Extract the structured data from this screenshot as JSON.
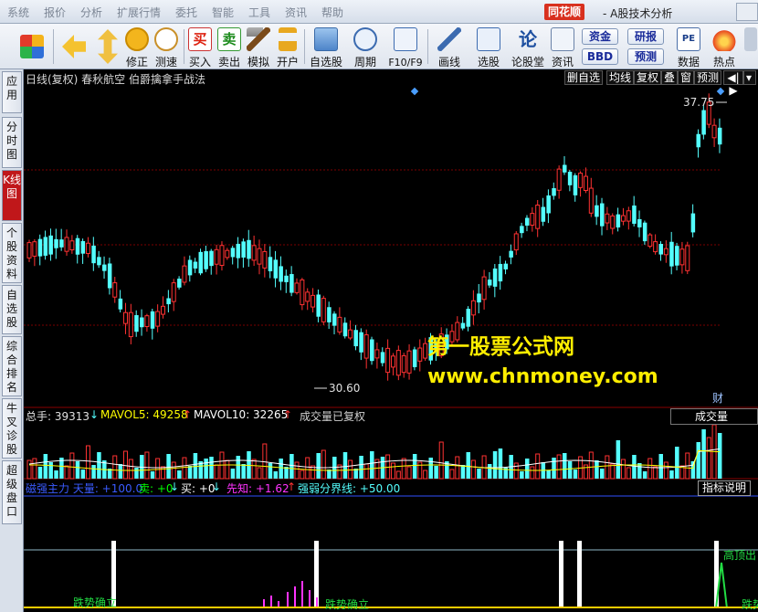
{
  "menu": {
    "items": [
      "系统",
      "报价",
      "分析",
      "扩展行情",
      "委托",
      "智能",
      "工具",
      "资讯",
      "帮助"
    ],
    "brand": "同花顺",
    "title": "- A股技术分析"
  },
  "toolbar": {
    "buttons": [
      {
        "icon": "color-blocks-icon",
        "label": ""
      },
      {
        "icon": "back-arrow-icon",
        "label": ""
      },
      {
        "icon": "updown-arrows-icon",
        "label": ""
      },
      {
        "icon": "fix-coin-icon",
        "label": "修正"
      },
      {
        "icon": "clock-icon",
        "label": "测速"
      },
      {
        "icon": "buy-icon",
        "label": "买入",
        "glyph": "买"
      },
      {
        "icon": "sell-icon",
        "label": "卖出",
        "glyph": "卖"
      },
      {
        "icon": "hammer-icon",
        "label": "模拟"
      },
      {
        "icon": "lock-icon",
        "label": "开户"
      },
      {
        "icon": "self-select-icon",
        "label": "自选股"
      },
      {
        "icon": "period-clock-icon",
        "label": "周期"
      },
      {
        "icon": "f10-icon",
        "label": "F10/F9"
      },
      {
        "icon": "pen-icon",
        "label": "画线"
      },
      {
        "icon": "stock-select-icon",
        "label": "选股"
      },
      {
        "icon": "forum-icon",
        "label": "论股堂",
        "glyph": "论"
      },
      {
        "icon": "news-icon",
        "label": "资讯"
      },
      {
        "icon": "pe-icon",
        "label": "数据",
        "glyph": "PE"
      },
      {
        "icon": "hot-icon",
        "label": "热点"
      }
    ],
    "pills": [
      "资金",
      "研报",
      "BBD",
      "预测"
    ]
  },
  "left_tabs": [
    {
      "label": "应用",
      "active": false
    },
    {
      "label": "分时图",
      "active": false
    },
    {
      "label": "K线图",
      "active": true
    },
    {
      "label": "个股资料",
      "active": false
    },
    {
      "label": "自选股",
      "active": false
    },
    {
      "label": "综合排名",
      "active": false
    },
    {
      "label": "牛叉诊股",
      "active": false
    },
    {
      "label": "超级盘口",
      "active": false
    }
  ],
  "chart_header": {
    "title": "日线(复权) 春秋航空 伯爵擒拿手战法",
    "buttons": [
      "删自选",
      "均线",
      "复权",
      "叠",
      "窗",
      "预测",
      "◀|▶"
    ]
  },
  "price_panel": {
    "high_label": "37.75",
    "low_label": "30.60",
    "cai_label": "财"
  },
  "watermark": {
    "line1": "第一股票公式网",
    "line2": "www.chnmoney.com"
  },
  "volume_info": {
    "total": "总手: 39313",
    "mavol5": "MAVOL5: 49258",
    "mavol10": "MAVOL10: 32265",
    "adjusted": "成交量已复权",
    "dropdown": "成交量"
  },
  "indicator_info": {
    "main": "磁强主力 天量: +100.0",
    "sell": "卖: +0",
    "buy": "买: +0",
    "xianzhi": "先知: +1.62",
    "qiangruo": "强弱分界线: +50.00",
    "explain": "指标说明"
  },
  "indicator_panel": {
    "labels": [
      "跌势确立",
      "跌势确立",
      "高顶出",
      "跌势"
    ]
  },
  "colors": {
    "up": "#ff3232",
    "down": "#54ffff",
    "ma_white": "#ffffff",
    "ma_yellow": "#ffff00",
    "grid": "#7a0000",
    "accent": "#d8301e"
  }
}
